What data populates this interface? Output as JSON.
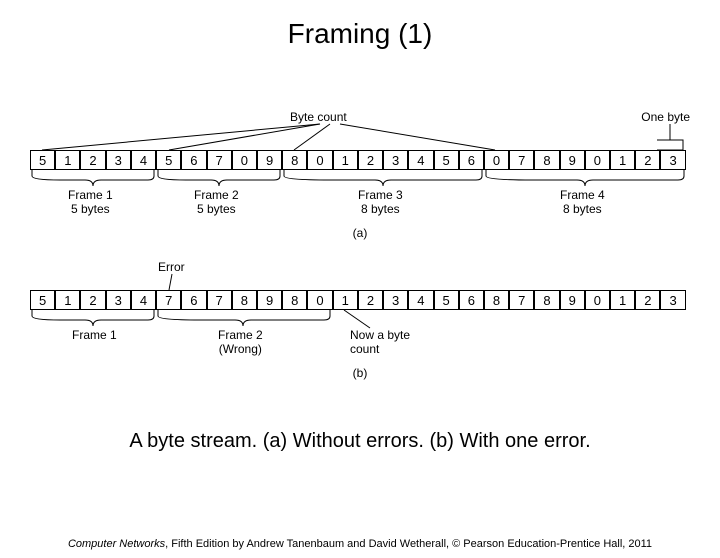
{
  "title": "Framing (1)",
  "caption": "A byte stream. (a) Without errors. (b) With one error.",
  "footer": {
    "book": "Computer Networks",
    "rest": ", Fifth Edition by Andrew Tanenbaum and David Wetherall, © Pearson Education-Prentice Hall, 2011"
  },
  "labels": {
    "byte_count": "Byte count",
    "one_byte": "One byte",
    "error": "Error",
    "now_a_byte_count": "Now a byte count",
    "sub_a": "(a)",
    "sub_b": "(b)"
  },
  "streamA": {
    "cells": [
      "5",
      "1",
      "2",
      "3",
      "4",
      "5",
      "6",
      "7",
      "0",
      "9",
      "8",
      "0",
      "1",
      "2",
      "3",
      "4",
      "5",
      "6",
      "0",
      "7",
      "8",
      "9",
      "0",
      "1",
      "2",
      "3"
    ],
    "count_indices": [
      0,
      5,
      10,
      18
    ],
    "frames": [
      {
        "name": "Frame 1",
        "bytes": "5 bytes"
      },
      {
        "name": "Frame 2",
        "bytes": "5 bytes"
      },
      {
        "name": "Frame 3",
        "bytes": "8 bytes"
      },
      {
        "name": "Frame 4",
        "bytes": "8 bytes"
      }
    ]
  },
  "streamB": {
    "cells": [
      "5",
      "1",
      "2",
      "3",
      "4",
      "7",
      "6",
      "7",
      "8",
      "9",
      "8",
      "0",
      "1",
      "2",
      "3",
      "4",
      "5",
      "6",
      "8",
      "7",
      "8",
      "9",
      "0",
      "1",
      "2",
      "3"
    ],
    "count_indices": [
      0,
      5
    ],
    "frames": [
      {
        "name": "Frame 1",
        "bytes": ""
      },
      {
        "name": "Frame 2",
        "bytes": "(Wrong)"
      }
    ]
  }
}
